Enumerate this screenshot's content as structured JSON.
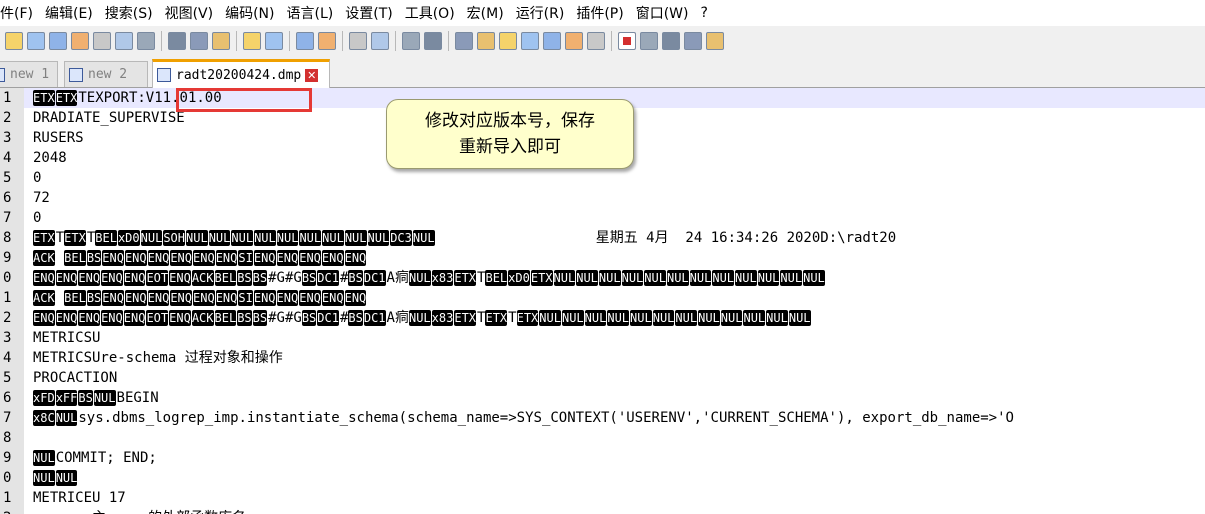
{
  "menu": [
    "件(F)",
    "编辑(E)",
    "搜索(S)",
    "视图(V)",
    "编码(N)",
    "语言(L)",
    "设置(T)",
    "工具(O)",
    "宏(M)",
    "运行(R)",
    "插件(P)",
    "窗口(W)",
    "?"
  ],
  "toolbar_icons": [
    "new-file-icon",
    "open-file-icon",
    "save-icon",
    "save-all-icon",
    "close-icon",
    "close-all-icon",
    "print-icon",
    "cut-icon",
    "copy-icon",
    "paste-icon",
    "undo-icon",
    "redo-icon",
    "find-icon",
    "replace-icon",
    "zoom-in-icon",
    "zoom-out-icon",
    "sync-vertical-icon",
    "sync-horizontal-icon",
    "word-wrap-icon",
    "show-all-chars-icon",
    "indent-guide-icon",
    "document-map-icon",
    "function-list-icon",
    "folder-workspace-icon",
    "monitor-icon",
    "record-macro-icon",
    "stop-macro-icon",
    "play-macro-icon",
    "run-macro-multiple-icon",
    "save-macro-icon"
  ],
  "tabs": [
    {
      "label": "new 1",
      "active": false
    },
    {
      "label": "new 2",
      "active": false
    },
    {
      "label": "radt20200424.dmp",
      "active": true
    }
  ],
  "lines": [
    {
      "num": "1",
      "segs": [
        {
          "c": "ETX"
        },
        {
          "c": "ETX"
        },
        {
          "t": "TEXPORT:V11.01.00"
        }
      ]
    },
    {
      "num": "2",
      "segs": [
        {
          "t": "DRADIATE_SUPERVISE"
        }
      ]
    },
    {
      "num": "3",
      "segs": [
        {
          "t": "RUSERS"
        }
      ]
    },
    {
      "num": "4",
      "segs": [
        {
          "t": "2048"
        }
      ]
    },
    {
      "num": "5",
      "segs": [
        {
          "t": "0"
        }
      ]
    },
    {
      "num": "6",
      "segs": [
        {
          "t": "72"
        }
      ]
    },
    {
      "num": "7",
      "segs": [
        {
          "t": "0"
        }
      ]
    },
    {
      "num": "8",
      "segs": [
        {
          "c": "ETX"
        },
        {
          "t": "T"
        },
        {
          "c": "ETX"
        },
        {
          "t": "T"
        },
        {
          "c": "BEL"
        },
        {
          "c": "xD0"
        },
        {
          "c": "NUL"
        },
        {
          "c": "SOH"
        },
        {
          "c": "NUL"
        },
        {
          "c": "NUL"
        },
        {
          "c": "NUL"
        },
        {
          "c": "NUL"
        },
        {
          "c": "NUL"
        },
        {
          "c": "NUL"
        },
        {
          "c": "NUL"
        },
        {
          "c": "NUL"
        },
        {
          "c": "NUL"
        },
        {
          "c": "DC3"
        },
        {
          "c": "NUL"
        },
        {
          "t": "                   星期五 4月  24 16:34:26 2020D:\\radt20"
        }
      ]
    },
    {
      "num": "9",
      "segs": [
        {
          "c": "ACK"
        },
        {
          "t": " "
        },
        {
          "c": "BEL"
        },
        {
          "c": "BS"
        },
        {
          "c": "ENQ"
        },
        {
          "c": "ENQ"
        },
        {
          "c": "ENQ"
        },
        {
          "c": "ENQ"
        },
        {
          "c": "ENQ"
        },
        {
          "c": "ENQ"
        },
        {
          "c": "SI"
        },
        {
          "c": "ENQ"
        },
        {
          "c": "ENQ"
        },
        {
          "c": "ENQ"
        },
        {
          "c": "ENQ"
        },
        {
          "c": "ENQ"
        }
      ]
    },
    {
      "num": "0",
      "segs": [
        {
          "c": "ENQ"
        },
        {
          "c": "ENQ"
        },
        {
          "c": "ENQ"
        },
        {
          "c": "ENQ"
        },
        {
          "c": "ENQ"
        },
        {
          "c": "EOT"
        },
        {
          "c": "ENQ"
        },
        {
          "c": "ACK"
        },
        {
          "c": "BEL"
        },
        {
          "c": "BS"
        },
        {
          "c": "BS"
        },
        {
          "t": "#G#G"
        },
        {
          "c": "BS"
        },
        {
          "c": "DC1"
        },
        {
          "t": "#"
        },
        {
          "c": "BS"
        },
        {
          "c": "DC1"
        },
        {
          "t": "A痌"
        },
        {
          "c": "NUL"
        },
        {
          "c": "x83"
        },
        {
          "c": "ETX"
        },
        {
          "t": "T"
        },
        {
          "c": "BEL"
        },
        {
          "c": "xD0"
        },
        {
          "c": "ETX"
        },
        {
          "c": "NUL"
        },
        {
          "c": "NUL"
        },
        {
          "c": "NUL"
        },
        {
          "c": "NUL"
        },
        {
          "c": "NUL"
        },
        {
          "c": "NUL"
        },
        {
          "c": "NUL"
        },
        {
          "c": "NUL"
        },
        {
          "c": "NUL"
        },
        {
          "c": "NUL"
        },
        {
          "c": "NUL"
        },
        {
          "c": "NUL"
        }
      ]
    },
    {
      "num": "1",
      "segs": [
        {
          "c": "ACK"
        },
        {
          "t": " "
        },
        {
          "c": "BEL"
        },
        {
          "c": "BS"
        },
        {
          "c": "ENQ"
        },
        {
          "c": "ENQ"
        },
        {
          "c": "ENQ"
        },
        {
          "c": "ENQ"
        },
        {
          "c": "ENQ"
        },
        {
          "c": "ENQ"
        },
        {
          "c": "SI"
        },
        {
          "c": "ENQ"
        },
        {
          "c": "ENQ"
        },
        {
          "c": "ENQ"
        },
        {
          "c": "ENQ"
        },
        {
          "c": "ENQ"
        }
      ]
    },
    {
      "num": "2",
      "segs": [
        {
          "c": "ENQ"
        },
        {
          "c": "ENQ"
        },
        {
          "c": "ENQ"
        },
        {
          "c": "ENQ"
        },
        {
          "c": "ENQ"
        },
        {
          "c": "EOT"
        },
        {
          "c": "ENQ"
        },
        {
          "c": "ACK"
        },
        {
          "c": "BEL"
        },
        {
          "c": "BS"
        },
        {
          "c": "BS"
        },
        {
          "t": "#G#G"
        },
        {
          "c": "BS"
        },
        {
          "c": "DC1"
        },
        {
          "t": "#"
        },
        {
          "c": "BS"
        },
        {
          "c": "DC1"
        },
        {
          "t": "A痌"
        },
        {
          "c": "NUL"
        },
        {
          "c": "x83"
        },
        {
          "c": "ETX"
        },
        {
          "t": "T"
        },
        {
          "c": "ETX"
        },
        {
          "t": "T"
        },
        {
          "c": "ETX"
        },
        {
          "c": "NUL"
        },
        {
          "c": "NUL"
        },
        {
          "c": "NUL"
        },
        {
          "c": "NUL"
        },
        {
          "c": "NUL"
        },
        {
          "c": "NUL"
        },
        {
          "c": "NUL"
        },
        {
          "c": "NUL"
        },
        {
          "c": "NUL"
        },
        {
          "c": "NUL"
        },
        {
          "c": "NUL"
        },
        {
          "c": "NUL"
        }
      ]
    },
    {
      "num": "3",
      "segs": [
        {
          "t": "METRICSU"
        }
      ]
    },
    {
      "num": "4",
      "segs": [
        {
          "t": "METRICSUre-schema 过程对象和操作"
        }
      ]
    },
    {
      "num": "5",
      "segs": [
        {
          "t": "PROCACTION"
        }
      ]
    },
    {
      "num": "6",
      "segs": [
        {
          "c": "xFD"
        },
        {
          "c": "xFF"
        },
        {
          "c": "BS"
        },
        {
          "c": "NUL"
        },
        {
          "t": "BEGIN"
        }
      ]
    },
    {
      "num": "7",
      "segs": [
        {
          "c": "x8C"
        },
        {
          "c": "NUL"
        },
        {
          "t": "sys.dbms_logrep_imp.instantiate_schema(schema_name=>SYS_CONTEXT('USERENV','CURRENT_SCHEMA'), export_db_name=>'O"
        }
      ]
    },
    {
      "num": "8",
      "segs": []
    },
    {
      "num": "9",
      "segs": [
        {
          "c": "NUL"
        },
        {
          "t": "COMMIT; END;"
        }
      ]
    },
    {
      "num": "0",
      "segs": [
        {
          "c": "NUL"
        },
        {
          "c": "NUL"
        }
      ]
    },
    {
      "num": "1",
      "segs": [
        {
          "t": "METRICEU 17"
        }
      ]
    },
    {
      "num": "2",
      "segs": [
        {
          "t": "       主     的外部函数库名"
        }
      ]
    }
  ],
  "callout": {
    "line1": "修改对应版本号，保存",
    "line2": "重新导入即可"
  },
  "colors": {
    "annotation_box": "#e53935",
    "callout_bg": "#ffffcc",
    "current_line": "#e8e8ff"
  }
}
